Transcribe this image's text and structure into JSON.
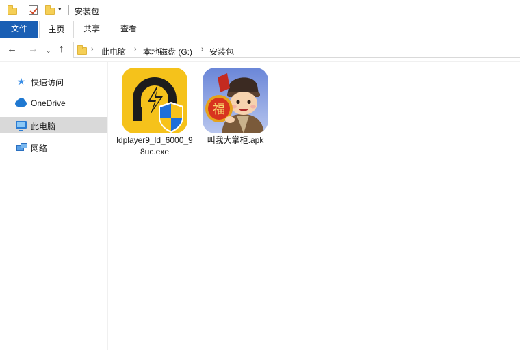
{
  "window": {
    "title": "安装包",
    "qa_dropdown": "▾"
  },
  "ribbon": {
    "tabs": [
      {
        "label": "文件"
      },
      {
        "label": "主页"
      },
      {
        "label": "共享"
      },
      {
        "label": "查看"
      }
    ]
  },
  "nav": {
    "back": "←",
    "forward": "→",
    "recent": "⌄",
    "up": "↑",
    "breadcrumb": [
      {
        "label": "此电脑"
      },
      {
        "label": "本地磁盘 (G:)"
      },
      {
        "label": "安装包"
      }
    ],
    "chevron": "›"
  },
  "sidebar": {
    "items": [
      {
        "label": "快速访问",
        "icon": "star-icon"
      },
      {
        "label": "OneDrive",
        "icon": "cloud-icon"
      },
      {
        "label": "此电脑",
        "icon": "computer-icon",
        "selected": true
      },
      {
        "label": "网络",
        "icon": "network-icon"
      }
    ]
  },
  "files": [
    {
      "name": "ldplayer9_ld_6000_98uc.exe",
      "icon": "ldplayer-app-icon"
    },
    {
      "name": "叫我大掌柜.apk",
      "icon": "game-app-icon",
      "badge_char": "福"
    }
  ],
  "colors": {
    "file_tab": "#1a5fb4",
    "selection": "#d9d9d9",
    "ldplayer_yellow": "#f5c21b",
    "shield_blue": "#1e6fd9",
    "shield_yellow": "#f7c21a"
  }
}
